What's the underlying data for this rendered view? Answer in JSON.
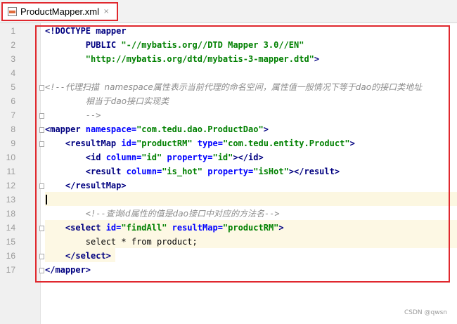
{
  "tab": {
    "filename": "ProductMapper.xml",
    "close_glyph": "×",
    "icon": "xml-file-icon"
  },
  "line_numbers": [
    "1",
    "2",
    "3",
    "4",
    "5",
    "6",
    "7",
    "8",
    "9",
    "10",
    "11",
    "12",
    "13",
    "14",
    "15",
    "16",
    "17",
    "18"
  ],
  "code": {
    "l1_a": "<!DOCTYPE mapper",
    "l2_a": "        PUBLIC ",
    "l2_b": "\"-//mybatis.org//DTD Mapper 3.0//EN\"",
    "l3_a": "        ",
    "l3_b": "\"http://mybatis.org/dtd/mybatis-3-mapper.dtd\"",
    "l3_c": ">",
    "l5_a": "<!--",
    "l5_b": "代理扫描  namespace属性表示当前代理的命名空间，属性值一般情况下等于dao的接口类地址",
    "l6_a": "        ",
    "l6_b": "相当于dao接口实现类",
    "l7_a": "        -->",
    "l8_tag_open": "<mapper ",
    "l8_attr": "namespace",
    "l8_eq": "=",
    "l8_val": "\"com.tedu.dao.ProductDao\"",
    "l8_close": ">",
    "l9_indent": "    ",
    "l9_tag": "<resultMap ",
    "l9_attr1": "id",
    "l9_eq1": "=",
    "l9_val1": "\"productRM\"",
    "l9_sp": " ",
    "l9_attr2": "type",
    "l9_eq2": "=",
    "l9_val2": "\"com.tedu.entity.Product\"",
    "l9_close": ">",
    "l10_indent": "        ",
    "l10_tag": "<id ",
    "l10_attr1": "column",
    "l10_eq1": "=",
    "l10_val1": "\"id\"",
    "l10_sp": " ",
    "l10_attr2": "property",
    "l10_eq2": "=",
    "l10_val2": "\"id\"",
    "l10_close": "></id>",
    "l11_indent": "        ",
    "l11_tag": "<result ",
    "l11_attr1": "column",
    "l11_eq1": "=",
    "l11_val1": "\"is_hot\"",
    "l11_sp": " ",
    "l11_attr2": "property",
    "l11_eq2": "=",
    "l11_val2": "\"isHot\"",
    "l11_close": "></result>",
    "l12_indent": "    ",
    "l12_tag": "</resultMap>",
    "l14_indent": "        ",
    "l14_a": "<!--",
    "l14_b": "查询id属性的值是dao接口中对应的方法名",
    "l14_c": "-->",
    "l15_indent": "    ",
    "l15_tag": "<select ",
    "l15_attr1": "id",
    "l15_eq1": "=",
    "l15_val1": "\"findAll\"",
    "l15_sp": " ",
    "l15_attr2": "resultMap",
    "l15_eq2": "=",
    "l15_val2": "\"productRM\"",
    "l15_close": ">",
    "l16_a": "        select * from product;",
    "l17_indent": "    ",
    "l17_tag": "</select>",
    "l18_tag": "</mapper>"
  },
  "watermark": "CSDN @qwsn",
  "colors": {
    "highlight_outline": "#e0282e",
    "tag": "#000080",
    "attribute": "#0000ff",
    "string": "#008000",
    "comment": "#8c8c8c",
    "current_line": "#fdf8e4"
  }
}
